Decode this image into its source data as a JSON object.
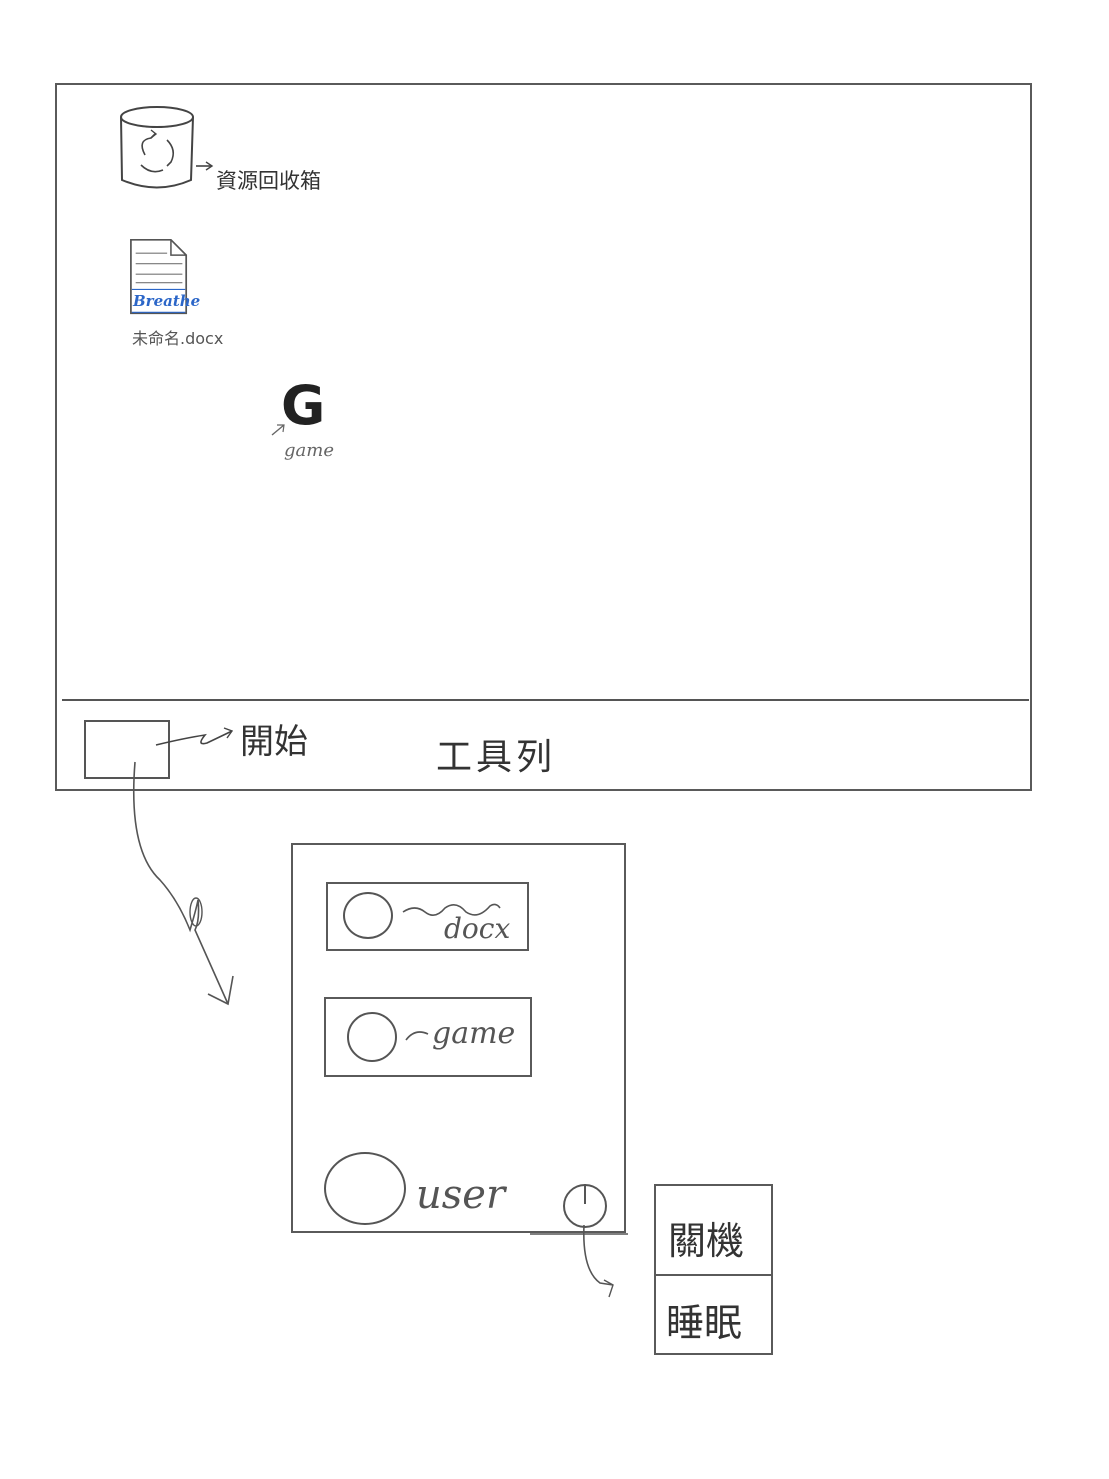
{
  "desktop": {
    "recycle_bin": {
      "label": "資源回收箱",
      "icon": "recycle-bin-icon"
    },
    "document": {
      "label": "未命名.docx",
      "icon_text": "Breathe",
      "icon": "document-icon"
    },
    "game": {
      "icon_letter": "G",
      "label": "game",
      "icon": "game-icon"
    }
  },
  "taskbar": {
    "start_label": "開始",
    "taskbar_label": "工具列"
  },
  "start_menu": {
    "items": [
      {
        "label": "docx"
      },
      {
        "label": "game"
      }
    ],
    "user_label": "user",
    "power_icon": "power-icon"
  },
  "power_menu": {
    "options": [
      "關機",
      "睡眠"
    ]
  }
}
